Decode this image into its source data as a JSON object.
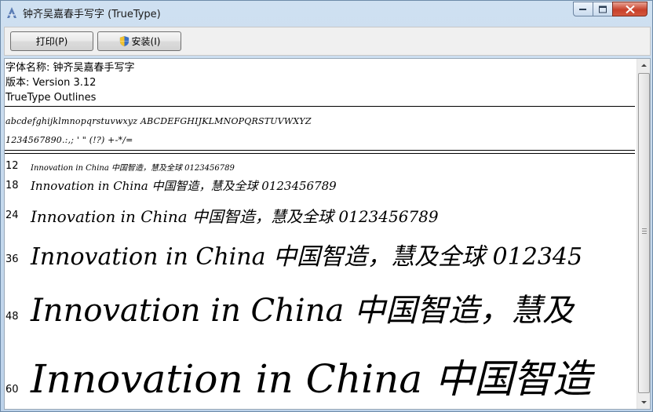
{
  "window": {
    "title": "钟齐吴嘉春手写字 (TrueType)",
    "icon": "font-icon"
  },
  "toolbar": {
    "print_label": "打印(P)",
    "install_label": "安装(I)"
  },
  "font_info": {
    "name_line": "字体名称: 钟齐吴嘉春手写字",
    "version_line": "版本: Version 3.12",
    "outline_line": "TrueType Outlines"
  },
  "charset": {
    "lower_upper": "abcdefghijklmnopqrstuvwxyz  ABCDEFGHIJKLMNOPQRSTUVWXYZ",
    "digits_symbols": "1234567890.:,;  '  \"  (!?)  +-*/="
  },
  "samples": [
    {
      "size": "12",
      "text": "Innovation  in  China  中国智造，慧及全球  0123456789"
    },
    {
      "size": "18",
      "text": "Innovation  in  China  中国智造，慧及全球  0123456789"
    },
    {
      "size": "24",
      "text": "Innovation  in  China  中国智造，慧及全球  0123456789"
    },
    {
      "size": "36",
      "text": "Innovation  in  China  中国智造，慧及全球  012345"
    },
    {
      "size": "48",
      "text": "Innovation  in  China  中国智造，慧及"
    },
    {
      "size": "60",
      "text": "Innovation  in  China  中国智造"
    }
  ],
  "colors": {
    "title_bar": "#cfe0f1",
    "close_button": "#c8412b",
    "content_bg": "#ffffff"
  }
}
